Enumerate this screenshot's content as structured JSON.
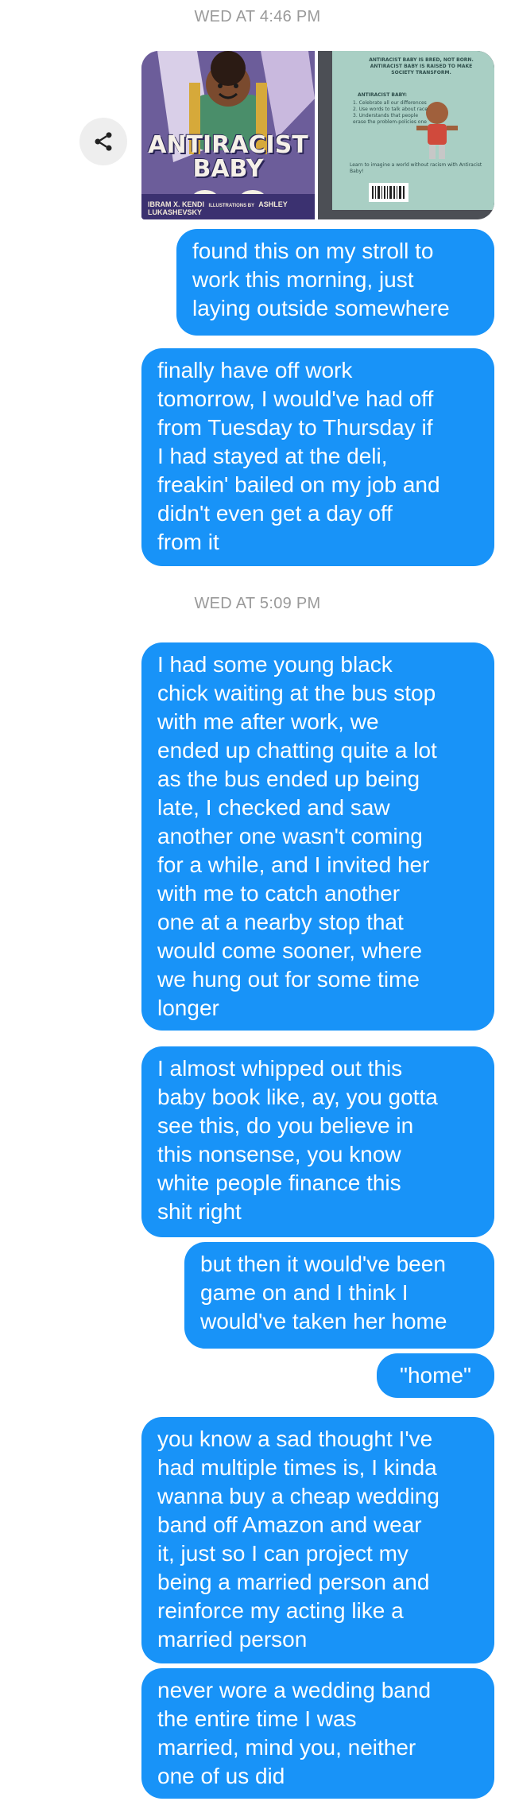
{
  "timestamps": {
    "first": "WED AT 4:46 PM",
    "second": "WED AT 5:09 PM"
  },
  "attachment": {
    "share_icon": "share-icon",
    "book_cover": {
      "title_line1": "ANTIRACIST",
      "title_line2": "BABY",
      "author": "IBRAM X. KENDI",
      "illustrations": "ILLUSTRATIONS BY",
      "illustrator": "ASHLEY LUKASHEVSKY"
    },
    "book_back": {
      "headline": "ANTIRACIST BABY IS BRED, NOT BORN. ANTIRACIST BABY IS RAISED TO MAKE SOCIETY TRANSFORM.",
      "steps_title": "ANTIRACIST BABY:",
      "steps": [
        "1. Celebrate all our differences",
        "2. Use words to talk about race",
        "3. Understands that people",
        "   erase the problem-policies one"
      ],
      "tagline": "Learn to imagine a world without racism with Antiracist Baby!"
    }
  },
  "messages": [
    "found this on my stroll to\nwork this morning, just\nlaying outside somewhere",
    "finally have off work\ntomorrow, I would've had off\nfrom Tuesday to Thursday if\nI had stayed at the deli,\nfreakin' bailed on my job and\ndidn't even get a day off\nfrom it",
    "I had some young black\nchick waiting at the bus stop\nwith me after work, we\nended up chatting quite a lot\nas the bus ended up being\nlate, I checked and saw\nanother one wasn't coming\nfor a while, and I invited her\nwith me to catch another\none at a nearby stop that\nwould come sooner, where\nwe hung out for some time\nlonger",
    "I almost whipped out this\nbaby book like, ay, you gotta\nsee this, do you believe in\nthis nonsense, you know\nwhite people finance this\nshit right",
    "but then it would've been\ngame on and I think I\nwould've taken her home",
    "\"home\"",
    "you know a sad thought I've\nhad multiple times is, I kinda\nwanna buy a cheap wedding\nband off Amazon and wear\nit, just so I can project my\nbeing a married person and\nreinforce my acting like a\nmarried person",
    "never wore a wedding band\nthe entire time I was\nmarried, mind you, neither\none of us did"
  ],
  "colors": {
    "bubble": "#1893f8",
    "bubble_text": "#ffffff",
    "timestamp": "#9a9a9a",
    "share_bg": "#eeeeee"
  }
}
